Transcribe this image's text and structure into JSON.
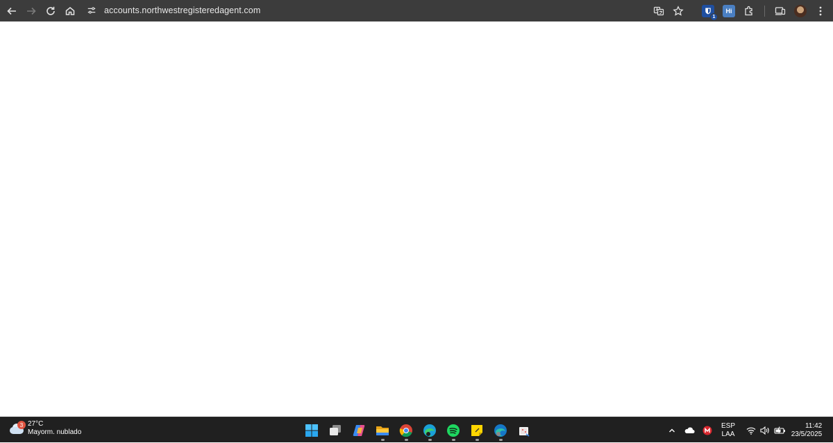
{
  "browser": {
    "url": "accounts.northwestregisteredagent.com",
    "extensions": [
      {
        "name": "bitwarden-extension",
        "label": "",
        "badge": "1",
        "color": "#1f4fa0"
      },
      {
        "name": "hi-extension",
        "label": "Hi",
        "color": "#4a7fc2"
      }
    ],
    "icons": [
      "back-icon",
      "forward-icon",
      "reload-icon",
      "home-icon",
      "site-info-icon",
      "translate-icon",
      "bookmark-star-icon",
      "extensions-puzzle-icon",
      "device-icon",
      "profile-avatar",
      "menu-kebab-icon"
    ]
  },
  "taskbar": {
    "weather": {
      "temp": "27°C",
      "condition": "Mayorm. nublado",
      "badge": "3"
    },
    "apps": [
      "start-icon",
      "task-view-icon",
      "copilot-icon",
      "file-explorer-icon",
      "chrome-icon",
      "edge-icon",
      "spotify-icon",
      "sticky-notes-icon",
      "edge-beta-icon",
      "snipping-tool-icon"
    ],
    "tray": {
      "lang_top": "ESP",
      "lang_bottom": "LAA",
      "time": "11:42",
      "date": "23/5/2025"
    }
  },
  "colors": {
    "toolbar": "#3c3c3c",
    "taskbar": "#202020",
    "page": "#ffffff"
  }
}
